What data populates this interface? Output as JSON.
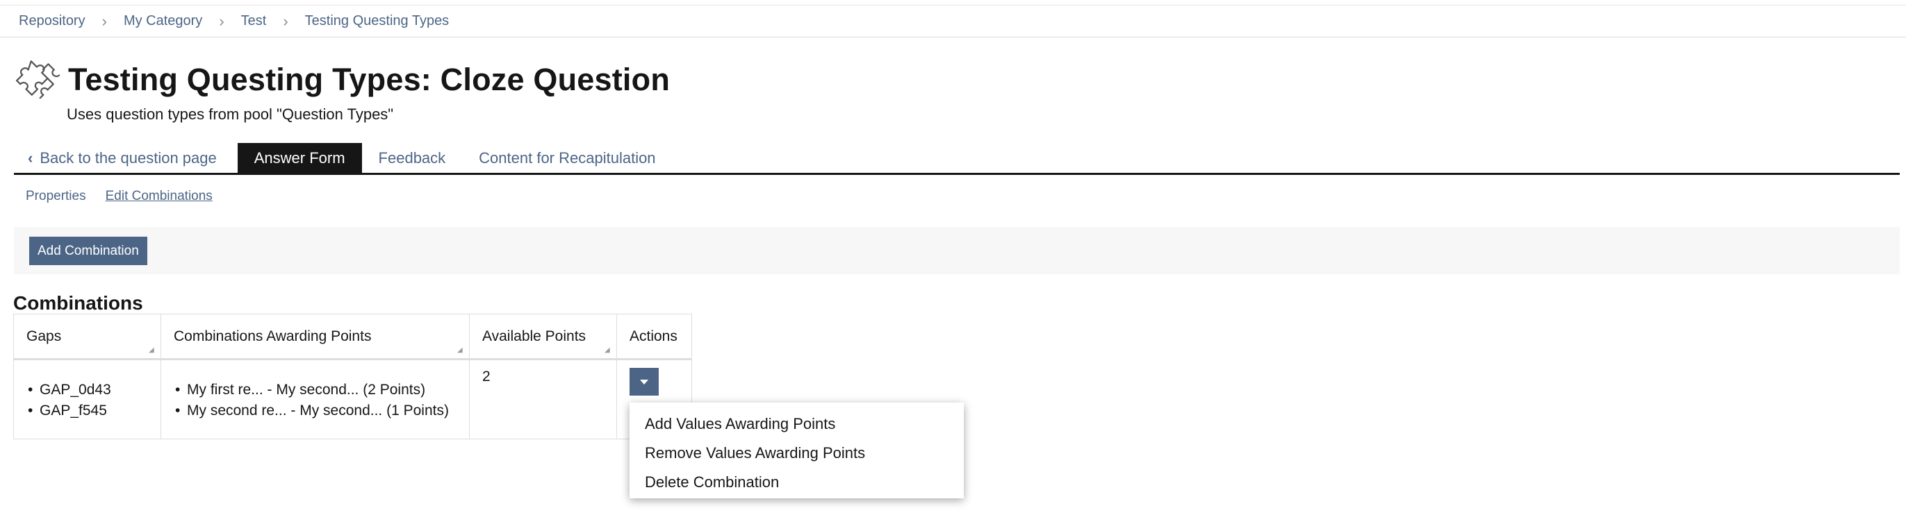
{
  "breadcrumb": {
    "items": [
      {
        "label": "Repository"
      },
      {
        "label": "My Category"
      },
      {
        "label": "Test"
      },
      {
        "label": "Testing Questing Types"
      }
    ]
  },
  "header": {
    "icon": "puzzle-icon",
    "title": "Testing Questing Types: Cloze Question",
    "description": "Uses question types from pool \"Question Types\""
  },
  "tabs": {
    "back": "Back to the question page",
    "items": [
      {
        "label": "Answer Form",
        "active": true
      },
      {
        "label": "Feedback",
        "active": false
      },
      {
        "label": "Content for Recapitulation",
        "active": false
      }
    ]
  },
  "subtabs": {
    "items": [
      {
        "label": "Properties",
        "active": false
      },
      {
        "label": "Edit Combinations",
        "active": true
      }
    ]
  },
  "toolbar": {
    "add_label": "Add Combination"
  },
  "section": {
    "title": "Combinations"
  },
  "table": {
    "headers": [
      "Gaps",
      "Combinations Awarding Points",
      "Available Points",
      "Actions"
    ],
    "rows": [
      {
        "gaps": [
          "GAP_0d43",
          "GAP_f545"
        ],
        "combinations": [
          "My first re... - My second... (2 Points)",
          "My second re... - My second... (1 Points)"
        ],
        "points": "2"
      }
    ]
  },
  "dropdown": {
    "items": [
      {
        "label": "Add Values Awarding Points"
      },
      {
        "label": "Remove Values Awarding Points"
      },
      {
        "label": "Delete Combination"
      }
    ]
  },
  "colors": {
    "accent": "#4c6586",
    "active_tab": "#161616",
    "toolbar_bg": "#f7f7f7"
  }
}
